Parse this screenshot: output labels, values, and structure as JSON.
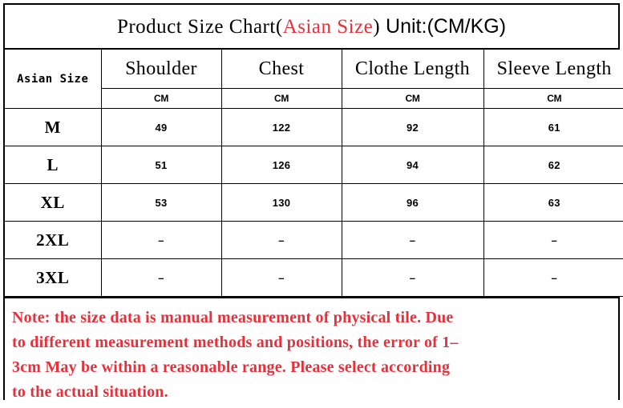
{
  "title": {
    "prefix": "Product Size Chart",
    "paren_open": "(",
    "accent": "Asian Size",
    "paren_close": ")",
    "unit": " Unit:(CM/KG)",
    "accent_color": "#e8303a"
  },
  "table": {
    "size_column_header": "Asian Size",
    "columns": [
      {
        "label": "Shoulder",
        "unit": "CM"
      },
      {
        "label": "Chest",
        "unit": "CM"
      },
      {
        "label": "Clothe Length",
        "unit": "CM"
      },
      {
        "label": "Sleeve Length",
        "unit": "CM"
      }
    ],
    "rows": [
      {
        "size": "M",
        "shoulder": "49",
        "chest": "122",
        "clothe_length": "92",
        "sleeve_length": "61"
      },
      {
        "size": "L",
        "shoulder": "51",
        "chest": "126",
        "clothe_length": "94",
        "sleeve_length": "62"
      },
      {
        "size": "XL",
        "shoulder": "53",
        "chest": "130",
        "clothe_length": "96",
        "sleeve_length": "63"
      },
      {
        "size": "2XL",
        "shoulder": "–",
        "chest": "–",
        "clothe_length": "–",
        "sleeve_length": "–"
      },
      {
        "size": "3XL",
        "shoulder": "–",
        "chest": "–",
        "clothe_length": "–",
        "sleeve_length": "–"
      }
    ]
  },
  "note": {
    "color": "#e8303a",
    "lines": [
      "Note: the size data is manual measurement of physical tile. Due",
      "to different measurement methods and positions, the error of 1–",
      "3cm May be within a reasonable range. Please select according",
      "to the actual situation."
    ]
  }
}
